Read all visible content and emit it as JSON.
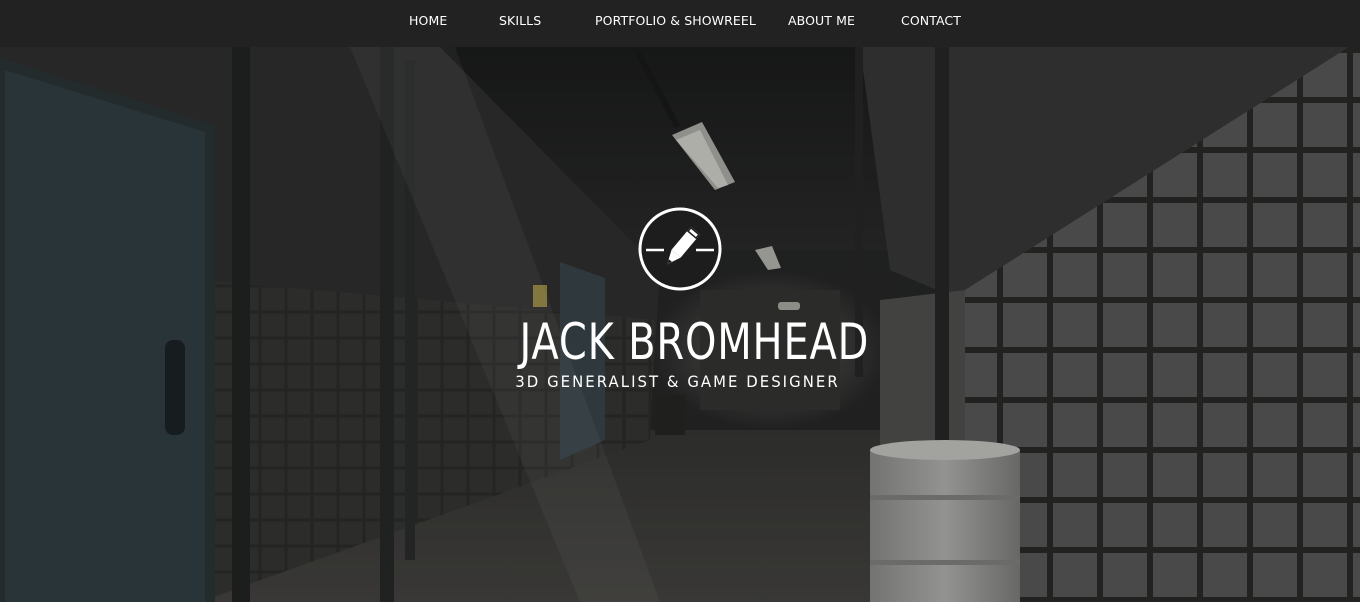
{
  "nav": {
    "items": [
      {
        "label": "HOME"
      },
      {
        "label": "SKILLS"
      },
      {
        "label": "PORTFOLIO & SHOWREEL"
      },
      {
        "label": "ABOUT ME"
      },
      {
        "label": "CONTACT"
      }
    ]
  },
  "hero": {
    "logo_icon": "pencil-circle-icon",
    "name": "JACK BROMHEAD",
    "tagline": "3D GENERALIST & GAME DESIGNER"
  },
  "colors": {
    "nav_background": "#222222",
    "text": "#ffffff"
  }
}
